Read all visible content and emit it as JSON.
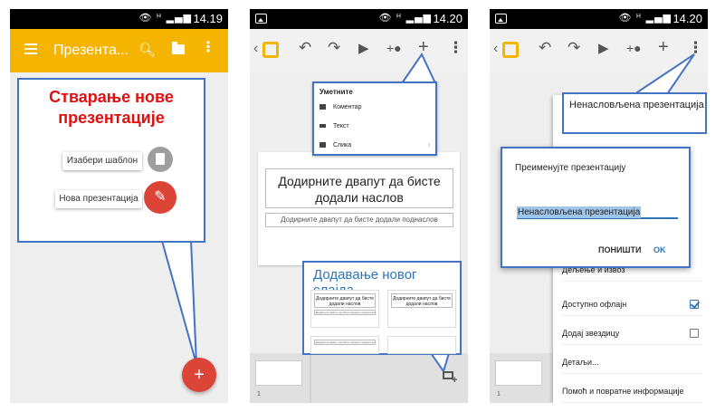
{
  "status": {
    "icons": "👁 ᴴ ▂▄▆",
    "time1": "14.19",
    "time2": "14.20",
    "time3": "14.20"
  },
  "panel1": {
    "app_title": "Презента...",
    "callout_title": "Стварање нове презентације",
    "choose_template": "Изабери шаблон",
    "new_presentation": "Нова презентација",
    "fab_plus": "+",
    "icons": [
      "menu-icon",
      "search-icon",
      "folder-icon",
      "more-icon",
      "document-icon",
      "pencil-icon",
      "plus-icon"
    ]
  },
  "panel2": {
    "insert_menu": {
      "header": "Уметните",
      "items": [
        {
          "label": "Коментар",
          "icon": "comment-icon"
        },
        {
          "label": "Текст",
          "icon": "text-icon"
        },
        {
          "label": "Слика",
          "icon": "image-icon"
        }
      ],
      "chevron": "›"
    },
    "slide_title": "Додирните двапут да бисте додали наслов",
    "slide_subtitle": "Додирните двапут да бисте додали поднаслов",
    "callout_title": "Додавање новог слајда",
    "layout_title": "Додирните двапут да бисте додали наслов",
    "layout_subtitle": "Додирните двапут да бисте додали поднаслов",
    "slide_number": "1",
    "toolbar_icons": [
      "back-icon",
      "slides-logo-icon",
      "undo-icon",
      "redo-icon",
      "play-icon",
      "add-person-icon",
      "plus-icon",
      "more-icon"
    ]
  },
  "panel3": {
    "callout_title": "Ненасловљена презентација",
    "dialog": {
      "title": "Преименујте презентацију",
      "value": "Ненасловљена презентација",
      "cancel": "ПОНИШТИ",
      "ok": "OK"
    },
    "menu_items": [
      {
        "label": "Дељење и извоз",
        "checkbox": null
      },
      {
        "label": "Доступно офлајн",
        "checkbox": true
      },
      {
        "label": "Додај звездицу",
        "checkbox": false
      },
      {
        "label": "Детаљи...",
        "checkbox": null
      },
      {
        "label": "Помоћ и повратне информације",
        "checkbox": null
      }
    ],
    "slide_number": "1"
  },
  "colors": {
    "yellow": "#f4b400",
    "red": "#db4437",
    "callout_border": "#4472c4",
    "accent_blue": "#2e75b6"
  }
}
